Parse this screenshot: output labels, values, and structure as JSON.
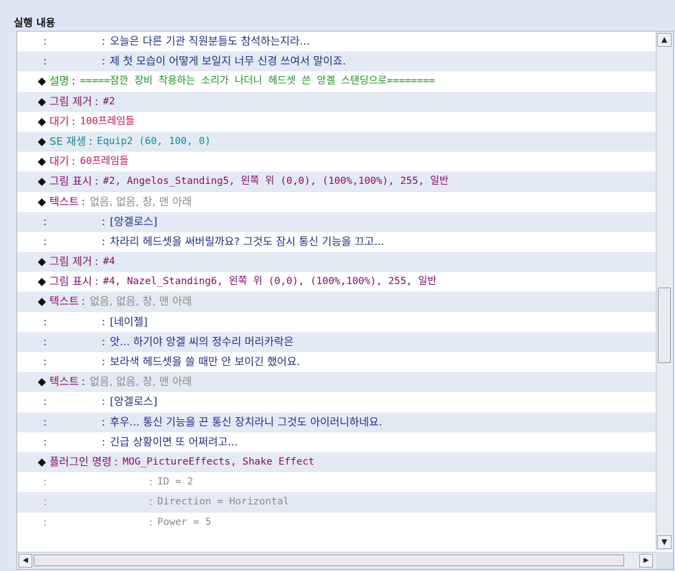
{
  "panel": {
    "title": "실행 내용"
  },
  "scrollbar": {
    "up_icon": "▲",
    "down_icon": "▼",
    "left_icon": "◀",
    "right_icon": "▶"
  },
  "colors": {
    "default": "#1f2f8f",
    "comment": "#1a9c1a",
    "picture": "#8b0a6e",
    "wait": "#d4145a",
    "se": "#0f8c98",
    "text_header": "#8b0a6e",
    "gray": "#8a8a8a",
    "plugin": "#8b0a6e"
  },
  "rows": [
    {
      "indent": "ind0",
      "bullet": "",
      "label": ":",
      "label_color": "default",
      "sep_pos": "p1",
      "sep": ":",
      "text": "오늘은 다른 기관 직원분들도 참석하는지라...",
      "text_color": "default",
      "mono": false
    },
    {
      "indent": "ind0",
      "bullet": "",
      "label": ":",
      "label_color": "default",
      "sep_pos": "p1",
      "sep": ":",
      "text": "제 첫 모습이 어떻게 보일지 너무 신경 쓰여서 말이죠.",
      "text_color": "default",
      "mono": false
    },
    {
      "indent": "ind0",
      "bullet": "◆",
      "label": "설명",
      "label_color": "comment",
      "sep_pos": "p0",
      "sep": ":",
      "text": "=====잠깐 장비 착용하는 소리가 나더니 헤드셋 쓴 앙겔 스탠딩으로========",
      "text_color": "comment",
      "mono": true
    },
    {
      "indent": "ind0",
      "bullet": "◆",
      "label": "그림 제거",
      "label_color": "picture",
      "sep_pos": "p0",
      "sep": ":",
      "text": "#2",
      "text_color": "picture",
      "mono": true
    },
    {
      "indent": "ind0",
      "bullet": "◆",
      "label": "대기",
      "label_color": "wait",
      "sep_pos": "p0",
      "sep": ":",
      "text": "100프레임들",
      "text_color": "wait",
      "mono": true
    },
    {
      "indent": "ind0",
      "bullet": "◆",
      "label": "SE 재생",
      "label_color": "se",
      "sep_pos": "p0",
      "sep": ":",
      "text": "Equip2 (60, 100, 0)",
      "text_color": "se",
      "mono": true
    },
    {
      "indent": "ind0",
      "bullet": "◆",
      "label": "대기",
      "label_color": "wait",
      "sep_pos": "p0",
      "sep": ":",
      "text": "60프레임들",
      "text_color": "wait",
      "mono": true
    },
    {
      "indent": "ind0",
      "bullet": "◆",
      "label": "그림 표시",
      "label_color": "picture",
      "sep_pos": "p0",
      "sep": ":",
      "text": "#2, Angelos_Standing5, 왼쪽 위 (0,0), (100%,100%), 255, 일반",
      "text_color": "picture",
      "mono": true
    },
    {
      "indent": "ind0",
      "bullet": "◆",
      "label": "텍스트",
      "label_color": "text_header",
      "sep_pos": "p0",
      "sep": ":",
      "text": "없음, 없음, 창, 맨 아래",
      "text_color": "gray",
      "mono": false
    },
    {
      "indent": "ind0",
      "bullet": "",
      "label": ":",
      "label_color": "default",
      "sep_pos": "p1",
      "sep": ":",
      "text": "[앙겔로스]",
      "text_color": "default",
      "mono": false
    },
    {
      "indent": "ind0",
      "bullet": "",
      "label": ":",
      "label_color": "default",
      "sep_pos": "p1",
      "sep": ":",
      "text": "차라리 헤드셋을 써버릴까요? 그것도 잠시 통신 기능을 끄고...",
      "text_color": "default",
      "mono": false
    },
    {
      "indent": "ind0",
      "bullet": "◆",
      "label": "그림 제거",
      "label_color": "picture",
      "sep_pos": "p0",
      "sep": ":",
      "text": "#4",
      "text_color": "picture",
      "mono": true
    },
    {
      "indent": "ind0",
      "bullet": "◆",
      "label": "그림 표시",
      "label_color": "picture",
      "sep_pos": "p0",
      "sep": ":",
      "text": "#4, Nazel_Standing6, 왼쪽 위 (0,0), (100%,100%), 255, 일반",
      "text_color": "picture",
      "mono": true
    },
    {
      "indent": "ind0",
      "bullet": "◆",
      "label": "텍스트",
      "label_color": "text_header",
      "sep_pos": "p0",
      "sep": ":",
      "text": "없음, 없음, 창, 맨 아래",
      "text_color": "gray",
      "mono": false
    },
    {
      "indent": "ind0",
      "bullet": "",
      "label": ":",
      "label_color": "default",
      "sep_pos": "p1",
      "sep": ":",
      "text": "[네이젤]",
      "text_color": "default",
      "mono": false
    },
    {
      "indent": "ind0",
      "bullet": "",
      "label": ":",
      "label_color": "default",
      "sep_pos": "p1",
      "sep": ":",
      "text": "앗... 하기야 앙겔 씨의 정수리 머리카락은",
      "text_color": "default",
      "mono": false
    },
    {
      "indent": "ind0",
      "bullet": "",
      "label": ":",
      "label_color": "default",
      "sep_pos": "p1",
      "sep": ":",
      "text": "보라색 헤드셋을 쓸 때만 안 보이긴 했어요.",
      "text_color": "default",
      "mono": false
    },
    {
      "indent": "ind0",
      "bullet": "◆",
      "label": "텍스트",
      "label_color": "text_header",
      "sep_pos": "p0",
      "sep": ":",
      "text": "없음, 없음, 창, 맨 아래",
      "text_color": "gray",
      "mono": false
    },
    {
      "indent": "ind0",
      "bullet": "",
      "label": ":",
      "label_color": "default",
      "sep_pos": "p1",
      "sep": ":",
      "text": "[앙겔로스]",
      "text_color": "default",
      "mono": false
    },
    {
      "indent": "ind0",
      "bullet": "",
      "label": ":",
      "label_color": "default",
      "sep_pos": "p1",
      "sep": ":",
      "text": "후우... 통신 기능을 끈 통신 장치라니 그것도 아이러니하네요.",
      "text_color": "default",
      "mono": false
    },
    {
      "indent": "ind0",
      "bullet": "",
      "label": ":",
      "label_color": "default",
      "sep_pos": "p1",
      "sep": ":",
      "text": "긴급 상황이면 또 어쩌려고...",
      "text_color": "default",
      "mono": false
    },
    {
      "indent": "ind0",
      "bullet": "◆",
      "label": "플러그인 명령",
      "label_color": "plugin",
      "sep_pos": "p0",
      "sep": ":",
      "text": "MOG_PictureEffects, Shake Effect",
      "text_color": "plugin",
      "mono": true
    },
    {
      "indent": "ind0",
      "bullet": "",
      "label": ":",
      "label_color": "gray",
      "sep_pos": "p2",
      "sep": ":",
      "text": "ID = 2",
      "text_color": "gray",
      "mono": true
    },
    {
      "indent": "ind0",
      "bullet": "",
      "label": ":",
      "label_color": "gray",
      "sep_pos": "p2",
      "sep": ":",
      "text": "Direction = Horizontal",
      "text_color": "gray",
      "mono": true
    },
    {
      "indent": "ind0",
      "bullet": "",
      "label": ":",
      "label_color": "gray",
      "sep_pos": "p2",
      "sep": ":",
      "text": "Power = 5",
      "text_color": "gray",
      "mono": true
    }
  ]
}
